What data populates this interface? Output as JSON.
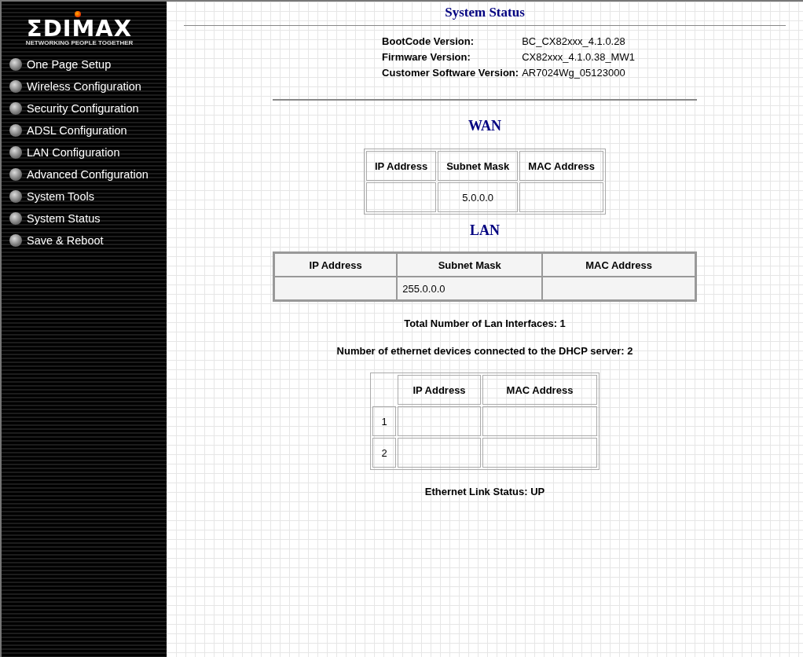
{
  "sidebar": {
    "logo": {
      "wordmark": "ΣDIMAX",
      "tagline": "NETWORKING PEOPLE TOGETHER"
    },
    "items": [
      {
        "label": "One Page Setup"
      },
      {
        "label": "Wireless Configuration"
      },
      {
        "label": "Security Configuration"
      },
      {
        "label": "ADSL Configuration"
      },
      {
        "label": "LAN Configuration"
      },
      {
        "label": "Advanced Configuration"
      },
      {
        "label": "System Tools"
      },
      {
        "label": "System Status"
      },
      {
        "label": "Save & Reboot"
      }
    ]
  },
  "page_title": "System Status",
  "versions": [
    {
      "label": "BootCode Version:",
      "value": "BC_CX82xxx_4.1.0.28"
    },
    {
      "label": "Firmware Version:",
      "value": "CX82xxx_4.1.0.38_MW1"
    },
    {
      "label": "Customer Software Version:",
      "value": "AR7024Wg_05123000"
    }
  ],
  "wan": {
    "title": "WAN",
    "columns": [
      "IP Address",
      "Subnet Mask",
      "MAC Address"
    ],
    "row": {
      "subnet_mask": "5.0.0.0"
    }
  },
  "lan": {
    "title": "LAN",
    "columns": [
      "IP Address",
      "Subnet Mask",
      "MAC Address"
    ],
    "row": {
      "subnet_mask": "255.0.0.0"
    }
  },
  "lan_interfaces": "Total Number of Lan Interfaces: 1",
  "dhcp_devices": "Number of ethernet devices connected to the DHCP server: 2",
  "dhcp_table": {
    "columns": [
      "IP Address",
      "MAC Address"
    ],
    "rows": [
      {
        "index": "1"
      },
      {
        "index": "2"
      }
    ]
  },
  "ethernet_link": "Ethernet Link Status: UP"
}
